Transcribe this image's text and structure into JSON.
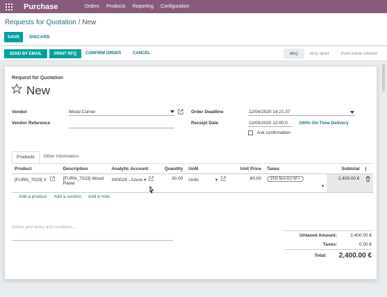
{
  "topbar": {
    "app_name": "Purchase",
    "menus": [
      "Orders",
      "Products",
      "Reporting",
      "Configuration"
    ]
  },
  "breadcrumb": {
    "parent": "Requests for Quotation",
    "separator": "/",
    "current": "New"
  },
  "actions": {
    "save": "SAVE",
    "discard": "DISCARD"
  },
  "statusbar": {
    "buttons": [
      "SEND BY EMAIL",
      "PRINT RFQ"
    ],
    "links": [
      "CONFIRM ORDER",
      "CANCEL"
    ],
    "stages": [
      "RFQ",
      "RFQ SENT",
      "PURCHASE ORDER"
    ],
    "active_stage": "RFQ"
  },
  "form": {
    "header_label": "Request for Quotation",
    "title": "New",
    "vendor_label": "Vendor",
    "vendor_value": "Wood Corner",
    "vendor_ref_label": "Vendor Reference",
    "vendor_ref_value": "",
    "order_deadline_label": "Order Deadline",
    "order_deadline_value": "12/04/2020 14:21:37",
    "receipt_date_label": "Receipt Date",
    "receipt_date_value": "12/05/2020 12:00:0",
    "on_time_delivery": "100% On-Time Delivery",
    "ask_confirmation_label": "Ask confirmation"
  },
  "tabs": [
    "Products",
    "Other Information"
  ],
  "order_lines": {
    "columns": [
      "Product",
      "Description",
      "Analytic Account",
      "Quantity",
      "UoM",
      "Unit Price",
      "Taxes",
      "Subtotal"
    ],
    "rows": [
      {
        "product": "[FURN_7023] V",
        "description_1": "[FURN_7023] Wood",
        "description_2": "Panel",
        "analytic": "S00028 - Azure",
        "quantity": "30.00",
        "uom": "Units",
        "unit_price": "80.00",
        "tax": "21% Non EU M",
        "subtotal": "2,400.00 €"
      }
    ],
    "add_links": [
      "Add a product",
      "Add a section",
      "Add a note"
    ]
  },
  "terms_placeholder": "Define your terms and conditions ...",
  "totals": {
    "untaxed_label": "Untaxed Amount:",
    "untaxed_value": "2,400.00 €",
    "taxes_label": "Taxes:",
    "taxes_value": "0.00 €",
    "total_label": "Total:",
    "total_value": "2,400.00 €"
  },
  "colors": {
    "brand": "#875a7b",
    "primary_button": "#00a09d",
    "link": "#1d6f7f"
  },
  "icons": [
    "apps-grid-icon",
    "star-icon",
    "external-link-icon",
    "dropdown-caret-icon",
    "checkbox-icon",
    "remove-tag-icon",
    "trash-icon",
    "mouse-cursor-icon"
  ]
}
